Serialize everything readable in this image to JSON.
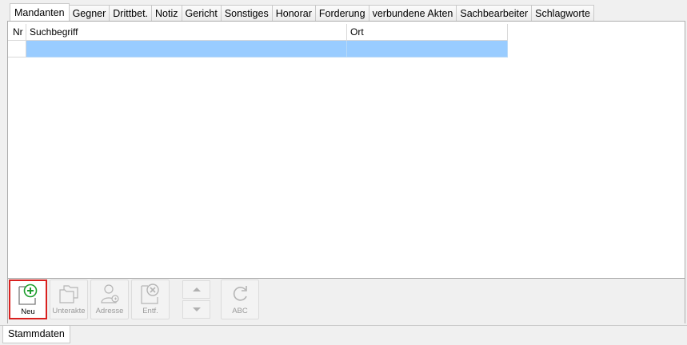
{
  "tabs": [
    "Mandanten",
    "Gegner",
    "Drittbet.",
    "Notiz",
    "Gericht",
    "Sonstiges",
    "Honorar",
    "Forderung",
    "verbundene Akten",
    "Sachbearbeiter",
    "Schlagworte"
  ],
  "grid": {
    "columns": {
      "nr": "Nr",
      "suchbegriff": "Suchbegriff",
      "ort": "Ort"
    },
    "rows": [
      {
        "nr": "",
        "suchbegriff": "",
        "ort": ""
      }
    ]
  },
  "toolbar": {
    "neu": "Neu",
    "unterakte": "Unterakte",
    "adresse": "Adresse",
    "entf": "Entf.",
    "abc": "ABC"
  },
  "bottom_tab": "Stammdaten",
  "colors": {
    "selection": "#99ccff",
    "highlight_border": "#d9201e",
    "add_icon": "#1e9e2e"
  }
}
